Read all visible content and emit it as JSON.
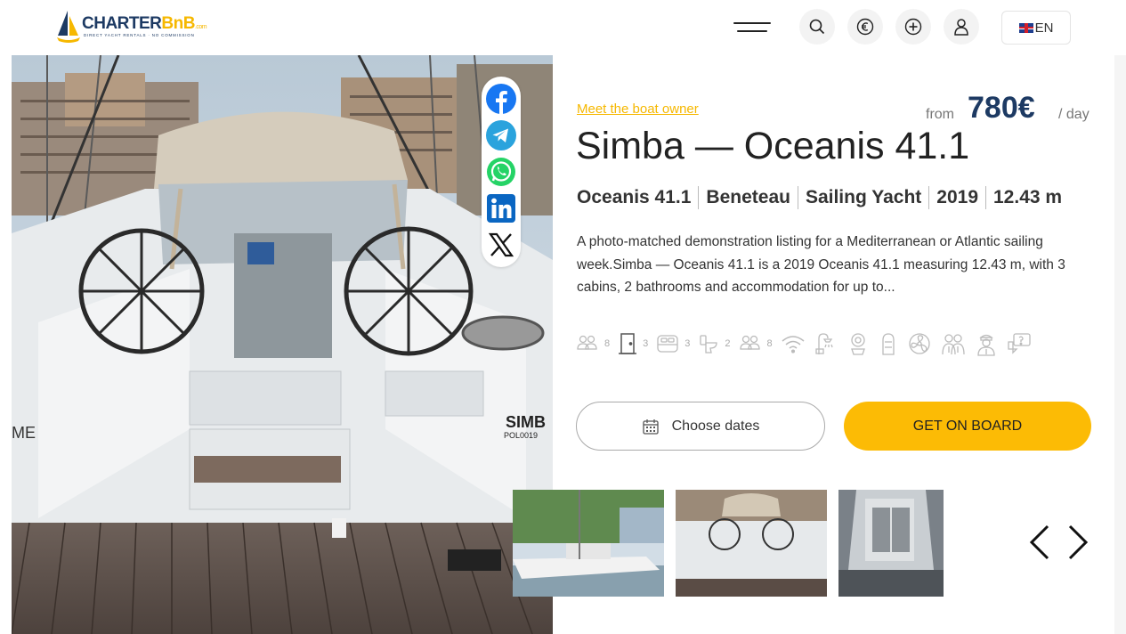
{
  "header": {
    "logo_name": "CHARTER",
    "logo_bnb": "BnB",
    "logo_com": ".com",
    "logo_tagline": "DIRECT YACHT RENTALS · NO COMMISSION",
    "language": "EN",
    "icons": [
      "menu-icon",
      "search-icon",
      "euro-icon",
      "plus-icon",
      "user-icon",
      "uk-flag-icon"
    ]
  },
  "listing": {
    "owner_link": "Meet the boat owner",
    "price_from": "from",
    "price": "780€",
    "price_unit": "/ day",
    "title": "Simba — Oceanis 41.1",
    "specs": [
      "Oceanis 41.1",
      "Beneteau",
      "Sailing Yacht",
      "2019",
      "12.43 m"
    ],
    "description": "A photo-matched demonstration listing for a Mediterranean or Atlantic sailing week.Simba — Oceanis 41.1 is a 2019 Oceanis 41.1 measuring 12.43 m, with 3 cabins, 2 bathrooms and accommodation for up to...",
    "amenities": [
      {
        "icon": "guests-icon",
        "count": "8"
      },
      {
        "icon": "door-icon",
        "count": "3"
      },
      {
        "icon": "bed-icon",
        "count": "3"
      },
      {
        "icon": "toilet-icon",
        "count": "2"
      },
      {
        "icon": "people-icon",
        "count": "8"
      },
      {
        "icon": "wifi-icon",
        "count": ""
      },
      {
        "icon": "shower-icon",
        "count": ""
      },
      {
        "icon": "buoy-icon",
        "count": ""
      },
      {
        "icon": "dinghy-icon",
        "count": ""
      },
      {
        "icon": "fan-icon",
        "count": ""
      },
      {
        "icon": "crew-icon",
        "count": ""
      },
      {
        "icon": "skipper-icon",
        "count": ""
      },
      {
        "icon": "chat-icon",
        "count": ""
      }
    ],
    "choose_dates": "Choose dates",
    "get_on_board": "GET ON BOARD"
  },
  "share": [
    "facebook-icon",
    "telegram-icon",
    "whatsapp-icon",
    "linkedin-icon",
    "x-icon"
  ],
  "photo_labels": {
    "stern_name": "SIMB",
    "stern_reg": "POL0019",
    "side_text": "ME"
  },
  "colors": {
    "brand_navy": "#1d3a63",
    "brand_yellow": "#fcbb05",
    "link_yellow": "#f6b800"
  }
}
